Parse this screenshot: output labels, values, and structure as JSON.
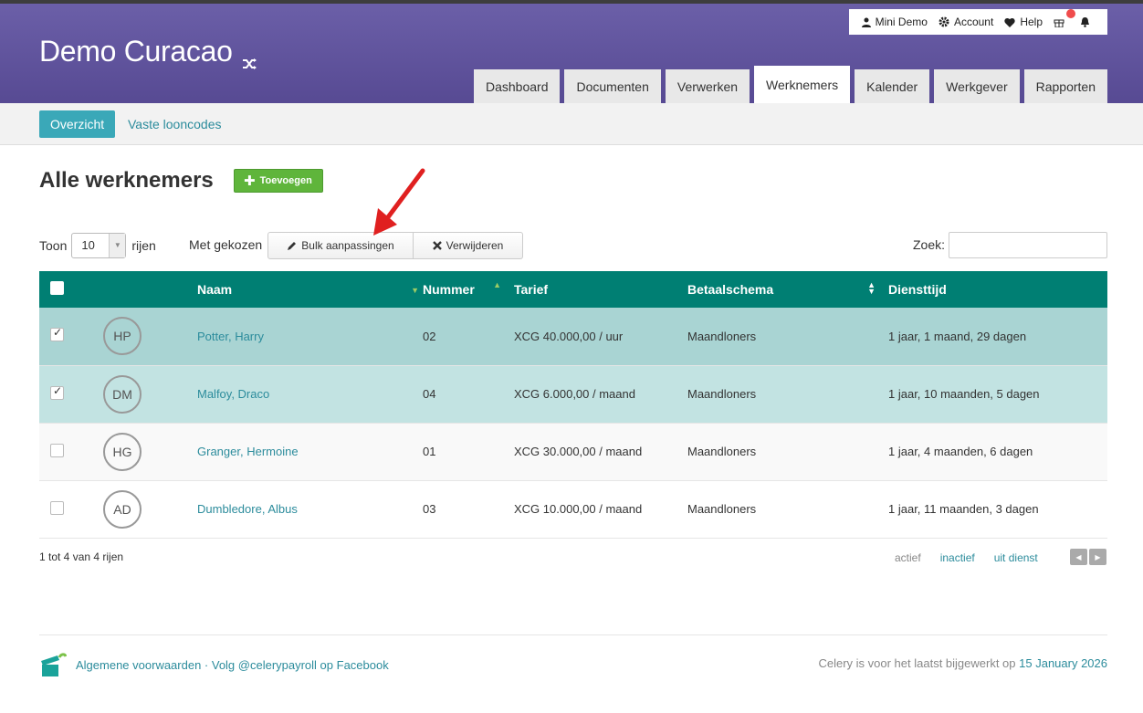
{
  "app": {
    "title": "Demo Curacao"
  },
  "topmenu": {
    "user": "Mini Demo",
    "account": "Account",
    "help": "Help"
  },
  "tabs": [
    "Dashboard",
    "Documenten",
    "Verwerken",
    "Werknemers",
    "Kalender",
    "Werkgever",
    "Rapporten"
  ],
  "active_tab": "Werknemers",
  "subnav": {
    "active": "Overzicht",
    "link": "Vaste looncodes"
  },
  "page": {
    "title": "Alle werknemers",
    "add_label": "Toevoegen"
  },
  "toolbar": {
    "show_label": "Toon",
    "rows_value": "10",
    "rows_label": "rijen",
    "with_selected": "Met gekozen",
    "bulk_label": "Bulk aanpassingen",
    "delete_label": "Verwijderen",
    "search_label": "Zoek:",
    "search_value": ""
  },
  "table": {
    "headers": [
      "Naam",
      "Nummer",
      "Tarief",
      "Betaalschema",
      "Diensttijd"
    ],
    "rows": [
      {
        "checked": true,
        "initials": "HP",
        "name": "Potter, Harry",
        "number": "02",
        "rate": "XCG 40.000,00 / uur",
        "schedule": "Maandloners",
        "tenure": "1 jaar, 1 maand, 29 dagen"
      },
      {
        "checked": true,
        "initials": "DM",
        "name": "Malfoy, Draco",
        "number": "04",
        "rate": "XCG 6.000,00 / maand",
        "schedule": "Maandloners",
        "tenure": "1 jaar, 10 maanden, 5 dagen"
      },
      {
        "checked": false,
        "initials": "HG",
        "name": "Granger, Hermoine",
        "number": "01",
        "rate": "XCG 30.000,00 / maand",
        "schedule": "Maandloners",
        "tenure": "1 jaar, 4 maanden, 6 dagen"
      },
      {
        "checked": false,
        "initials": "AD",
        "name": "Dumbledore, Albus",
        "number": "03",
        "rate": "XCG 10.000,00 / maand",
        "schedule": "Maandloners",
        "tenure": "1 jaar, 11 maanden, 3 dagen"
      }
    ]
  },
  "table_footer": {
    "info": "1 tot 4 van 4 rijen",
    "filters": [
      "actief",
      "inactief",
      "uit dienst"
    ]
  },
  "footer": {
    "left": "Algemene voorwaarden · Volg @celerypayroll op Facebook",
    "right_prefix": "Celery is voor het laatst bijgewerkt op",
    "right_date": "15 January 2026"
  },
  "colors": {
    "header_purple": "#574a93",
    "teal": "#007f73",
    "link": "#2c8c9c",
    "add_green": "#5fb53b",
    "annotation_arrow": "#e02020"
  }
}
